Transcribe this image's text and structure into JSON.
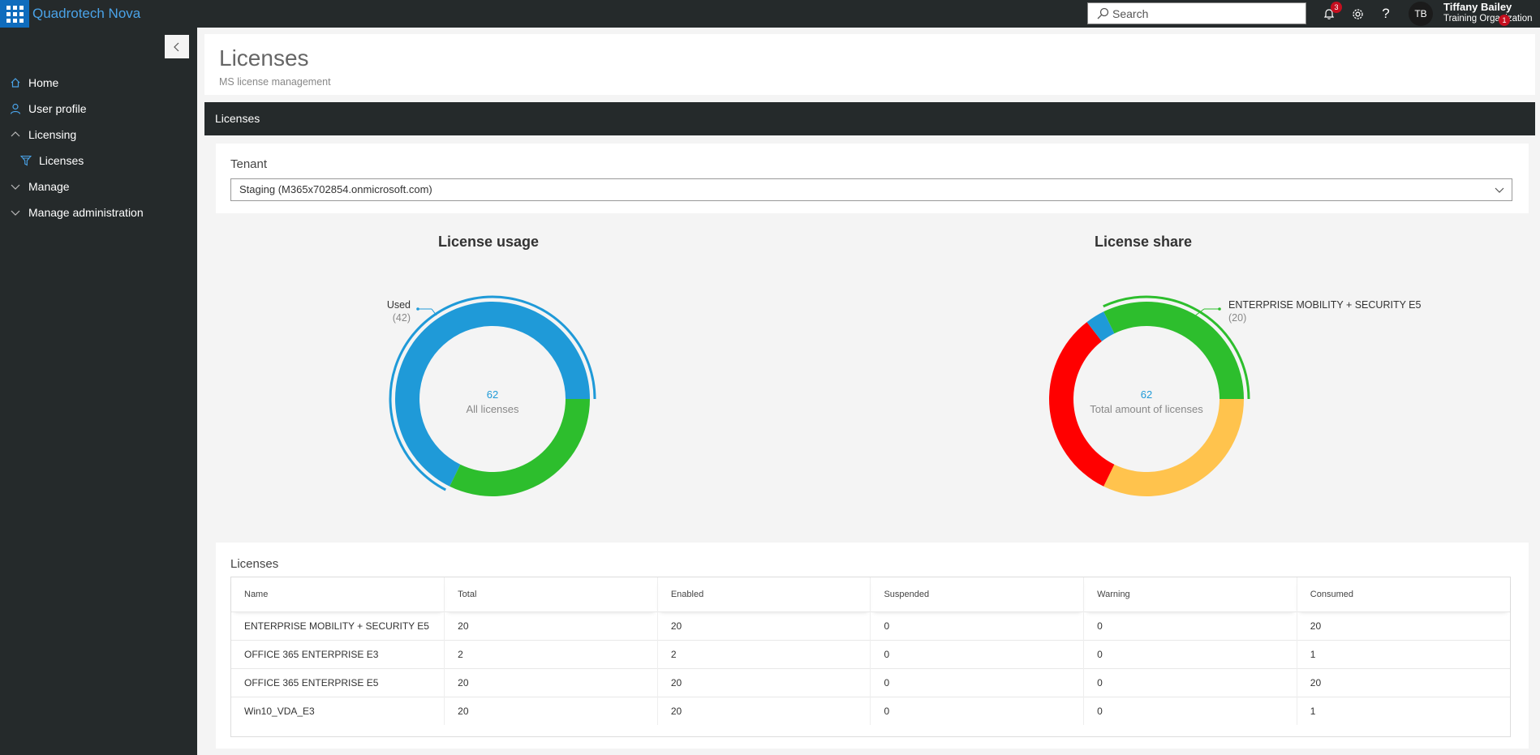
{
  "app": {
    "brand": "Quadrotech Nova"
  },
  "topbar": {
    "search_placeholder": "Search",
    "notifications_count": "3",
    "user_initials": "TB",
    "user_name": "Tiffany Bailey",
    "user_org": "Training Organization",
    "org_badge_count": "1"
  },
  "sidebar": {
    "items": [
      {
        "label": "Home",
        "icon": "home-icon"
      },
      {
        "label": "User profile",
        "icon": "person-icon"
      },
      {
        "label": "Licensing",
        "icon": "chevron-up-icon"
      },
      {
        "label": "Licenses",
        "icon": "filter-icon"
      },
      {
        "label": "Manage",
        "icon": "chevron-down-icon"
      },
      {
        "label": "Manage administration",
        "icon": "chevron-down-icon"
      }
    ]
  },
  "page": {
    "title": "Licenses",
    "subtitle": "MS license management",
    "section_title": "Licenses"
  },
  "tenant": {
    "label": "Tenant",
    "selected": "Staging (M365x702854.onmicrosoft.com)"
  },
  "colors": {
    "blue": "#1f9ad8",
    "green": "#2dbe2d",
    "yellow": "#ffc34d",
    "red": "#ff0000",
    "dark": "#252a2b"
  },
  "usage_chart": {
    "title": "License usage",
    "center_value": "62",
    "center_label": "All licenses",
    "highlight_label": "Used",
    "highlight_value": "(42)",
    "segments": [
      {
        "value": 42,
        "color": "#1f9ad8",
        "highlight": true
      },
      {
        "value": 20,
        "color": "#2dbe2d",
        "highlight": false
      }
    ]
  },
  "share_chart": {
    "title": "License share",
    "center_value": "62",
    "center_label": "Total amount of licenses",
    "highlight_label": "ENTERPRISE MOBILITY + SECURITY E5",
    "highlight_value": "(20)",
    "segments": [
      {
        "value": 20,
        "color": "#2dbe2d",
        "highlight": true
      },
      {
        "value": 20,
        "color": "#ffc34d",
        "highlight": false
      },
      {
        "value": 20,
        "color": "#ff0000",
        "highlight": false
      },
      {
        "value": 2,
        "color": "#1f9ad8",
        "highlight": false
      }
    ]
  },
  "licenses_table": {
    "label": "Licenses",
    "columns": [
      "Name",
      "Total",
      "Enabled",
      "Suspended",
      "Warning",
      "Consumed"
    ],
    "rows": [
      [
        "ENTERPRISE MOBILITY + SECURITY E5",
        "20",
        "20",
        "0",
        "0",
        "20"
      ],
      [
        "OFFICE 365 ENTERPRISE E3",
        "2",
        "2",
        "0",
        "0",
        "1"
      ],
      [
        "OFFICE 365 ENTERPRISE E5",
        "20",
        "20",
        "0",
        "0",
        "20"
      ],
      [
        "Win10_VDA_E3",
        "20",
        "20",
        "0",
        "0",
        "1"
      ]
    ]
  }
}
